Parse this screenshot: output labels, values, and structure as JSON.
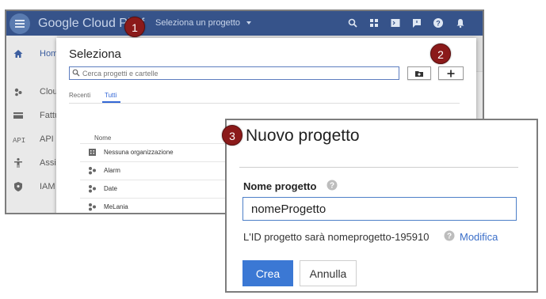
{
  "console": {
    "title": "Google Cloud Platf",
    "project_selector": "Seleziona un progetto",
    "nav": [
      {
        "icon": "home-icon",
        "label": "Hom"
      },
      {
        "icon": "cloud-icon",
        "label": "Clou"
      },
      {
        "icon": "billing-icon",
        "label": "Fattu"
      },
      {
        "icon": "api-icon",
        "label": "API a"
      },
      {
        "icon": "support-icon",
        "label": "Assi"
      },
      {
        "icon": "shield-icon",
        "label": "IAM"
      }
    ],
    "toolbar_icons": [
      "search-icon",
      "apps-icon",
      "terminal-icon",
      "feedback-icon",
      "help-icon",
      "notifications-icon"
    ]
  },
  "select_dialog": {
    "title": "Seleziona",
    "search_placeholder": "Cerca progetti e cartelle",
    "tabs": [
      "Recenti",
      "Tutti"
    ],
    "active_tab": "Tutti",
    "column_header": "Nome",
    "rows": [
      {
        "icon": "organization-icon",
        "name": "Nessuna organizzazione"
      },
      {
        "icon": "project-icon",
        "name": "Alarm"
      },
      {
        "icon": "project-icon",
        "name": "Date"
      },
      {
        "icon": "project-icon",
        "name": "MeLania"
      }
    ]
  },
  "new_project": {
    "title": "Nuovo progetto",
    "name_label": "Nome progetto",
    "name_value": "nomeProgetto",
    "id_text": "L'ID progetto sarà nomeprogetto-195910",
    "modify_link": "Modifica",
    "create_label": "Crea",
    "cancel_label": "Annulla"
  },
  "badges": [
    "1",
    "2",
    "3"
  ],
  "colors": {
    "badge": "#8b1a1a",
    "topbar": "#36538a",
    "primary_button": "#3b78d4",
    "link": "#3b6fc9"
  }
}
